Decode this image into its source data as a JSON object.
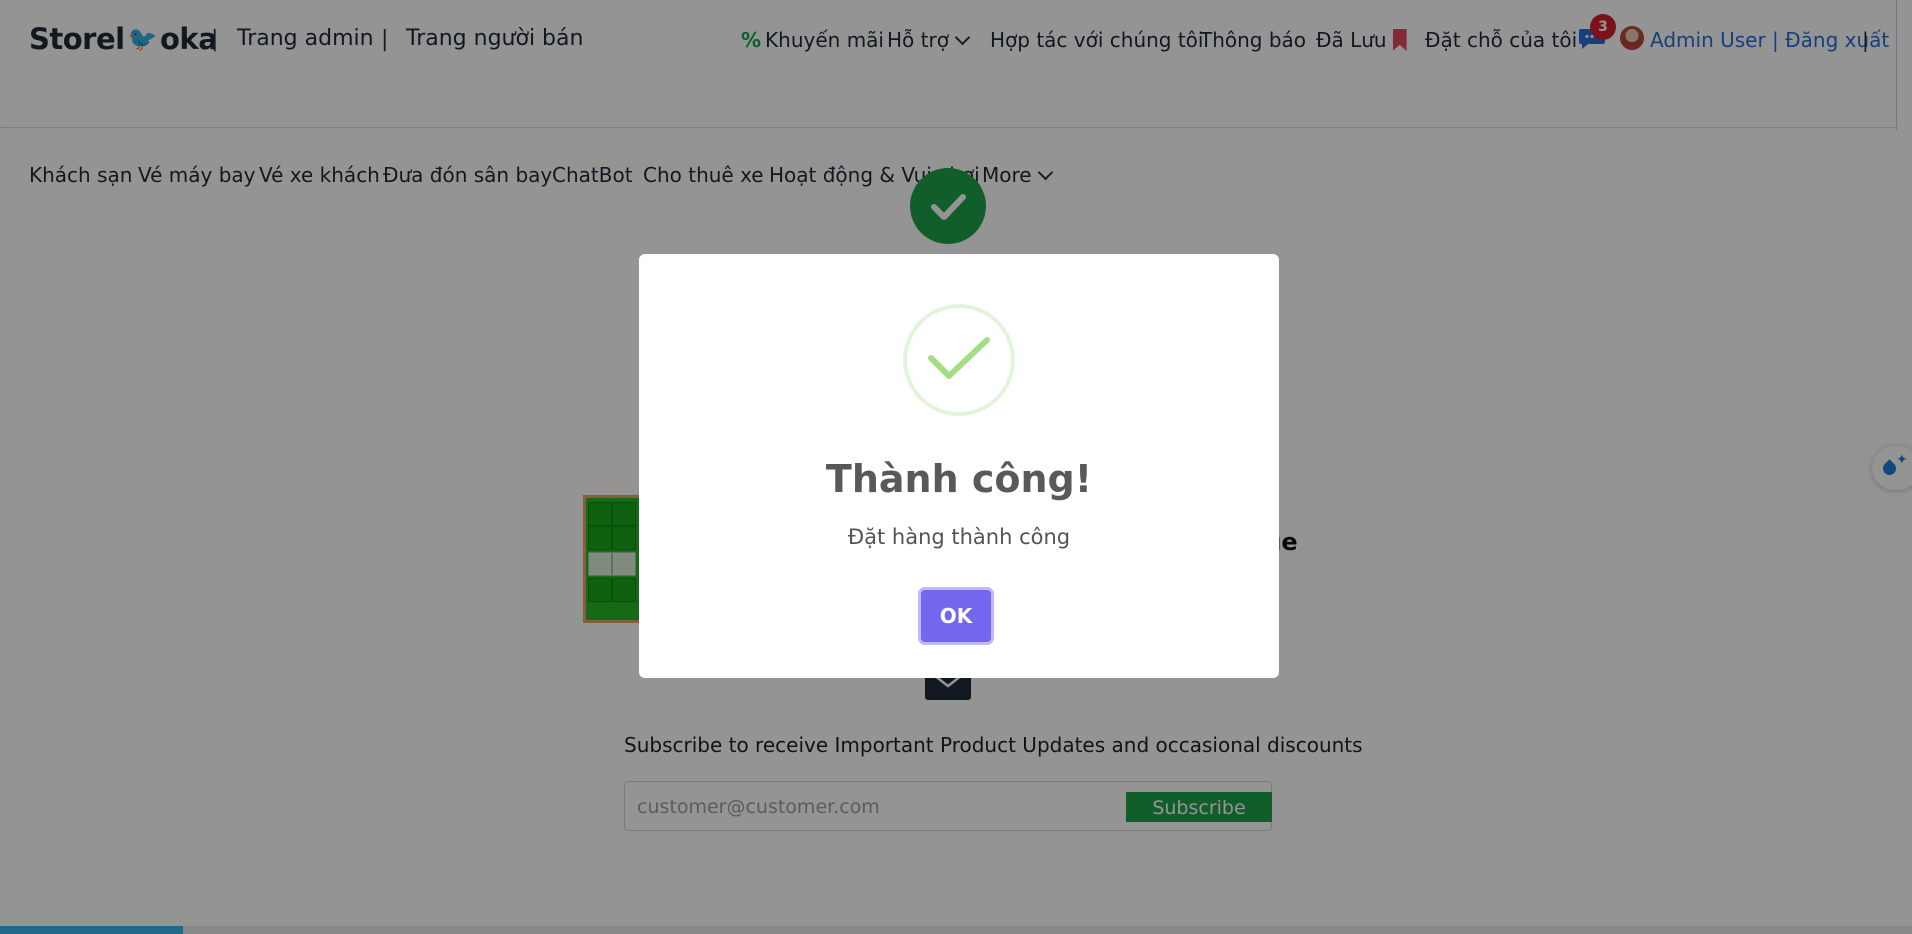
{
  "header": {
    "brand_left": "Storel",
    "brand_right": "oka",
    "separator": "|",
    "admin_link": "Trang admin",
    "seller_link": "Trang người bán",
    "promotions_icon": "%",
    "promotions": "Khuyến mãi",
    "support": "Hỗ trợ",
    "partner": "Hợp tác với chúng tôi",
    "notifications": "Thông báo",
    "saved": "Đã Lưu",
    "my_bookings": "Đặt chỗ của tôi",
    "chat_badge": "3",
    "user_link": "Admin User | Đăng xuất",
    "trailing_separator": "|"
  },
  "nav": {
    "items": [
      "Khách sạn",
      "Vé máy bay",
      "Vé xe khách",
      "Đưa đón sân bay",
      "ChatBot",
      "Cho thuê xe",
      "Hoạt động & Vui chơi"
    ],
    "more": "More"
  },
  "page": {
    "title_fragment": "age",
    "subscribe_text": "Subscribe to receive Important Product Updates and occasional discounts",
    "subscribe_placeholder": "customer@customer.com",
    "subscribe_button": "Subscribe"
  },
  "modal": {
    "title": "Thành công!",
    "message": "Đặt hàng thành công",
    "ok_label": "OK"
  },
  "colors": {
    "accent_button": "#7367f0",
    "success_check": "#a5dc86",
    "green": "#1fa24a",
    "link_blue": "#2a6bd8"
  }
}
